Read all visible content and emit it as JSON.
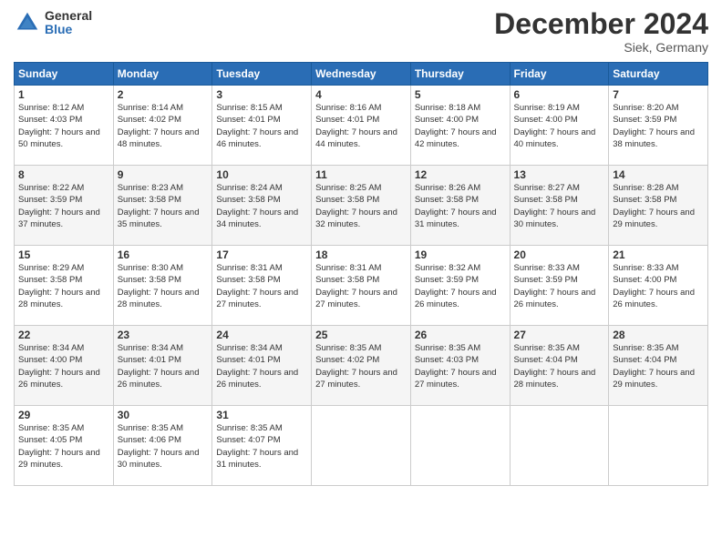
{
  "header": {
    "logo_general": "General",
    "logo_blue": "Blue",
    "month_title": "December 2024",
    "subtitle": "Siek, Germany"
  },
  "weekdays": [
    "Sunday",
    "Monday",
    "Tuesday",
    "Wednesday",
    "Thursday",
    "Friday",
    "Saturday"
  ],
  "weeks": [
    [
      {
        "day": "1",
        "sunrise": "Sunrise: 8:12 AM",
        "sunset": "Sunset: 4:03 PM",
        "daylight": "Daylight: 7 hours and 50 minutes."
      },
      {
        "day": "2",
        "sunrise": "Sunrise: 8:14 AM",
        "sunset": "Sunset: 4:02 PM",
        "daylight": "Daylight: 7 hours and 48 minutes."
      },
      {
        "day": "3",
        "sunrise": "Sunrise: 8:15 AM",
        "sunset": "Sunset: 4:01 PM",
        "daylight": "Daylight: 7 hours and 46 minutes."
      },
      {
        "day": "4",
        "sunrise": "Sunrise: 8:16 AM",
        "sunset": "Sunset: 4:01 PM",
        "daylight": "Daylight: 7 hours and 44 minutes."
      },
      {
        "day": "5",
        "sunrise": "Sunrise: 8:18 AM",
        "sunset": "Sunset: 4:00 PM",
        "daylight": "Daylight: 7 hours and 42 minutes."
      },
      {
        "day": "6",
        "sunrise": "Sunrise: 8:19 AM",
        "sunset": "Sunset: 4:00 PM",
        "daylight": "Daylight: 7 hours and 40 minutes."
      },
      {
        "day": "7",
        "sunrise": "Sunrise: 8:20 AM",
        "sunset": "Sunset: 3:59 PM",
        "daylight": "Daylight: 7 hours and 38 minutes."
      }
    ],
    [
      {
        "day": "8",
        "sunrise": "Sunrise: 8:22 AM",
        "sunset": "Sunset: 3:59 PM",
        "daylight": "Daylight: 7 hours and 37 minutes."
      },
      {
        "day": "9",
        "sunrise": "Sunrise: 8:23 AM",
        "sunset": "Sunset: 3:58 PM",
        "daylight": "Daylight: 7 hours and 35 minutes."
      },
      {
        "day": "10",
        "sunrise": "Sunrise: 8:24 AM",
        "sunset": "Sunset: 3:58 PM",
        "daylight": "Daylight: 7 hours and 34 minutes."
      },
      {
        "day": "11",
        "sunrise": "Sunrise: 8:25 AM",
        "sunset": "Sunset: 3:58 PM",
        "daylight": "Daylight: 7 hours and 32 minutes."
      },
      {
        "day": "12",
        "sunrise": "Sunrise: 8:26 AM",
        "sunset": "Sunset: 3:58 PM",
        "daylight": "Daylight: 7 hours and 31 minutes."
      },
      {
        "day": "13",
        "sunrise": "Sunrise: 8:27 AM",
        "sunset": "Sunset: 3:58 PM",
        "daylight": "Daylight: 7 hours and 30 minutes."
      },
      {
        "day": "14",
        "sunrise": "Sunrise: 8:28 AM",
        "sunset": "Sunset: 3:58 PM",
        "daylight": "Daylight: 7 hours and 29 minutes."
      }
    ],
    [
      {
        "day": "15",
        "sunrise": "Sunrise: 8:29 AM",
        "sunset": "Sunset: 3:58 PM",
        "daylight": "Daylight: 7 hours and 28 minutes."
      },
      {
        "day": "16",
        "sunrise": "Sunrise: 8:30 AM",
        "sunset": "Sunset: 3:58 PM",
        "daylight": "Daylight: 7 hours and 28 minutes."
      },
      {
        "day": "17",
        "sunrise": "Sunrise: 8:31 AM",
        "sunset": "Sunset: 3:58 PM",
        "daylight": "Daylight: 7 hours and 27 minutes."
      },
      {
        "day": "18",
        "sunrise": "Sunrise: 8:31 AM",
        "sunset": "Sunset: 3:58 PM",
        "daylight": "Daylight: 7 hours and 27 minutes."
      },
      {
        "day": "19",
        "sunrise": "Sunrise: 8:32 AM",
        "sunset": "Sunset: 3:59 PM",
        "daylight": "Daylight: 7 hours and 26 minutes."
      },
      {
        "day": "20",
        "sunrise": "Sunrise: 8:33 AM",
        "sunset": "Sunset: 3:59 PM",
        "daylight": "Daylight: 7 hours and 26 minutes."
      },
      {
        "day": "21",
        "sunrise": "Sunrise: 8:33 AM",
        "sunset": "Sunset: 4:00 PM",
        "daylight": "Daylight: 7 hours and 26 minutes."
      }
    ],
    [
      {
        "day": "22",
        "sunrise": "Sunrise: 8:34 AM",
        "sunset": "Sunset: 4:00 PM",
        "daylight": "Daylight: 7 hours and 26 minutes."
      },
      {
        "day": "23",
        "sunrise": "Sunrise: 8:34 AM",
        "sunset": "Sunset: 4:01 PM",
        "daylight": "Daylight: 7 hours and 26 minutes."
      },
      {
        "day": "24",
        "sunrise": "Sunrise: 8:34 AM",
        "sunset": "Sunset: 4:01 PM",
        "daylight": "Daylight: 7 hours and 26 minutes."
      },
      {
        "day": "25",
        "sunrise": "Sunrise: 8:35 AM",
        "sunset": "Sunset: 4:02 PM",
        "daylight": "Daylight: 7 hours and 27 minutes."
      },
      {
        "day": "26",
        "sunrise": "Sunrise: 8:35 AM",
        "sunset": "Sunset: 4:03 PM",
        "daylight": "Daylight: 7 hours and 27 minutes."
      },
      {
        "day": "27",
        "sunrise": "Sunrise: 8:35 AM",
        "sunset": "Sunset: 4:04 PM",
        "daylight": "Daylight: 7 hours and 28 minutes."
      },
      {
        "day": "28",
        "sunrise": "Sunrise: 8:35 AM",
        "sunset": "Sunset: 4:04 PM",
        "daylight": "Daylight: 7 hours and 29 minutes."
      }
    ],
    [
      {
        "day": "29",
        "sunrise": "Sunrise: 8:35 AM",
        "sunset": "Sunset: 4:05 PM",
        "daylight": "Daylight: 7 hours and 29 minutes."
      },
      {
        "day": "30",
        "sunrise": "Sunrise: 8:35 AM",
        "sunset": "Sunset: 4:06 PM",
        "daylight": "Daylight: 7 hours and 30 minutes."
      },
      {
        "day": "31",
        "sunrise": "Sunrise: 8:35 AM",
        "sunset": "Sunset: 4:07 PM",
        "daylight": "Daylight: 7 hours and 31 minutes."
      },
      null,
      null,
      null,
      null
    ]
  ]
}
